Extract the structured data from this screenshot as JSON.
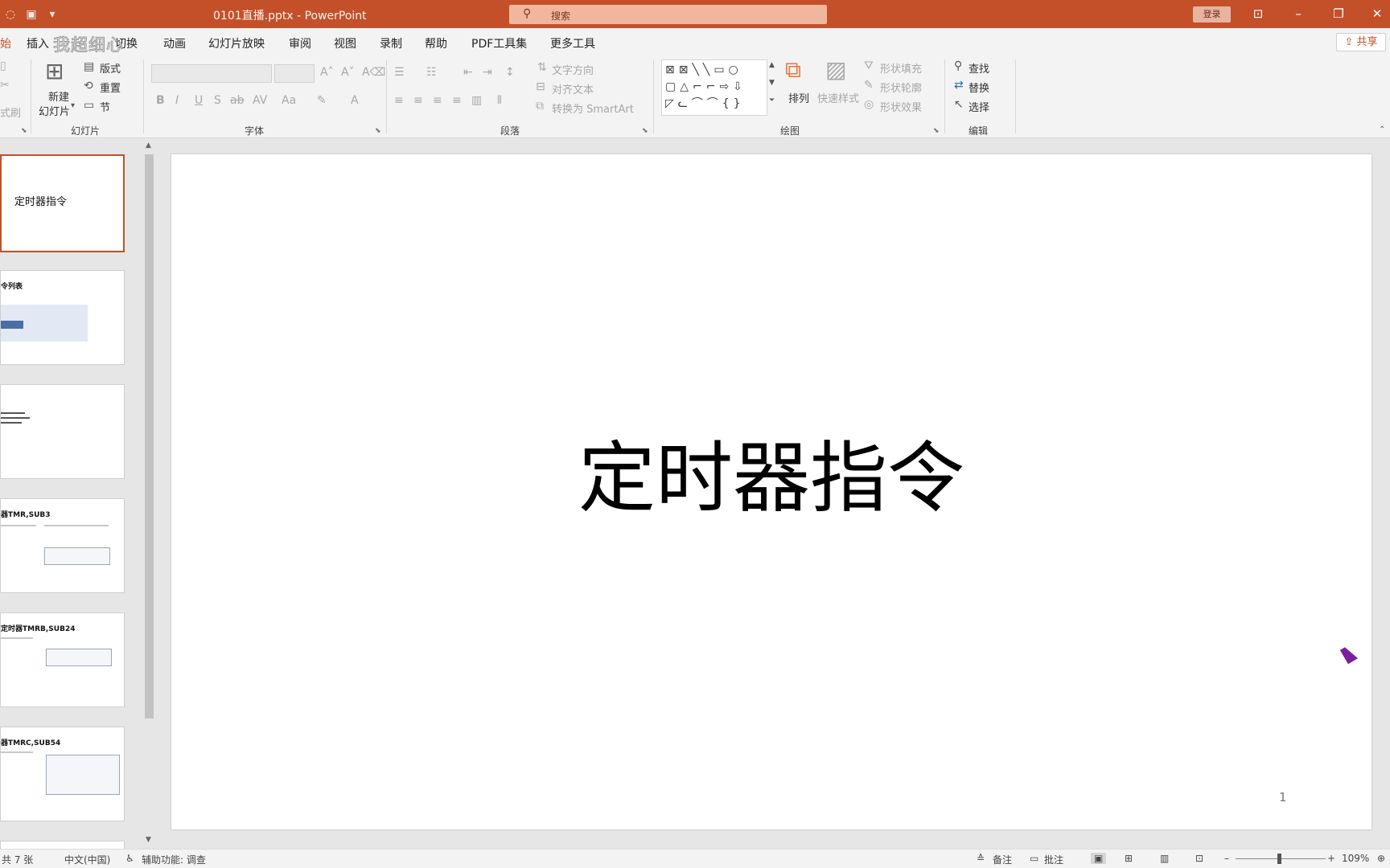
{
  "title_bar": {
    "document_title": "0101直播.pptx - PowerPoint",
    "search_icon": "search-icon",
    "search_placeholder": "搜索",
    "login_label": "登录",
    "window_controls": [
      "ribbon-display-icon",
      "minimize-icon",
      "restore-icon",
      "close-icon"
    ],
    "accent_color": "#c4502a"
  },
  "tabs": {
    "items": [
      "插入",
      "切换",
      "动画",
      "幻灯片放映",
      "审阅",
      "视图",
      "录制",
      "帮助",
      "PDF工具集",
      "更多工具"
    ],
    "share_label": "共享",
    "watermark": "我超细心"
  },
  "ribbon": {
    "slides_group": {
      "new_slide": "新建",
      "new_slide_sub": "幻灯片",
      "layout": "版式",
      "reset": "重置",
      "section": "节",
      "label": "幻灯片"
    },
    "font_group": {
      "label": "字体"
    },
    "paragraph_group": {
      "text_direction": "文字方向",
      "align_text": "对齐文本",
      "convert_smartart": "转换为 SmartArt",
      "label": "段落"
    },
    "drawing_group": {
      "arrange": "排列",
      "quick_styles": "快速样式",
      "shape_fill": "形状填充",
      "shape_outline": "形状轮廓",
      "shape_effects": "形状效果",
      "label": "绘图"
    },
    "editing_group": {
      "find": "查找",
      "replace": "替换",
      "select": "选择",
      "label": "编辑"
    }
  },
  "thumbnails": {
    "slide1_title": "定时器指令",
    "slide2_title": "令列表",
    "slide4_title": "器TMR,SUB3",
    "slide5_title": "定时器TMRB,SUB24",
    "slide6_title": "器TMRC,SUB54"
  },
  "slide": {
    "title": "定时器指令",
    "page_number": "1"
  },
  "status_bar": {
    "slide_count": "共 7 张",
    "language": "中文(中国)",
    "accessibility": "辅助功能: 调查",
    "notes": "备注",
    "comments": "批注",
    "zoom": "109%"
  }
}
